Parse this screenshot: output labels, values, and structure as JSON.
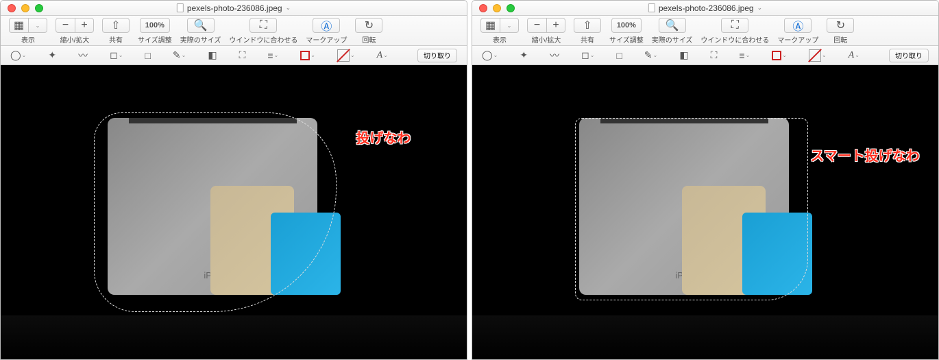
{
  "windows": [
    {
      "title": "pexels-photo-236086.jpeg",
      "label": "投げなわ",
      "selection": "lasso"
    },
    {
      "title": "pexels-photo-236086.jpeg",
      "label": "スマート投げなわ",
      "selection": "smart"
    }
  ],
  "toolbar": {
    "view": "表示",
    "zoom": "縮小/拡大",
    "share": "共有",
    "resize": "サイズ調整",
    "actualsize": "実際のサイズ",
    "fitwindow": "ウインドウに合わせる",
    "markup": "マークアップ",
    "rotate": "回転",
    "zoomlevel": "100%",
    "crop": "切り取り"
  }
}
